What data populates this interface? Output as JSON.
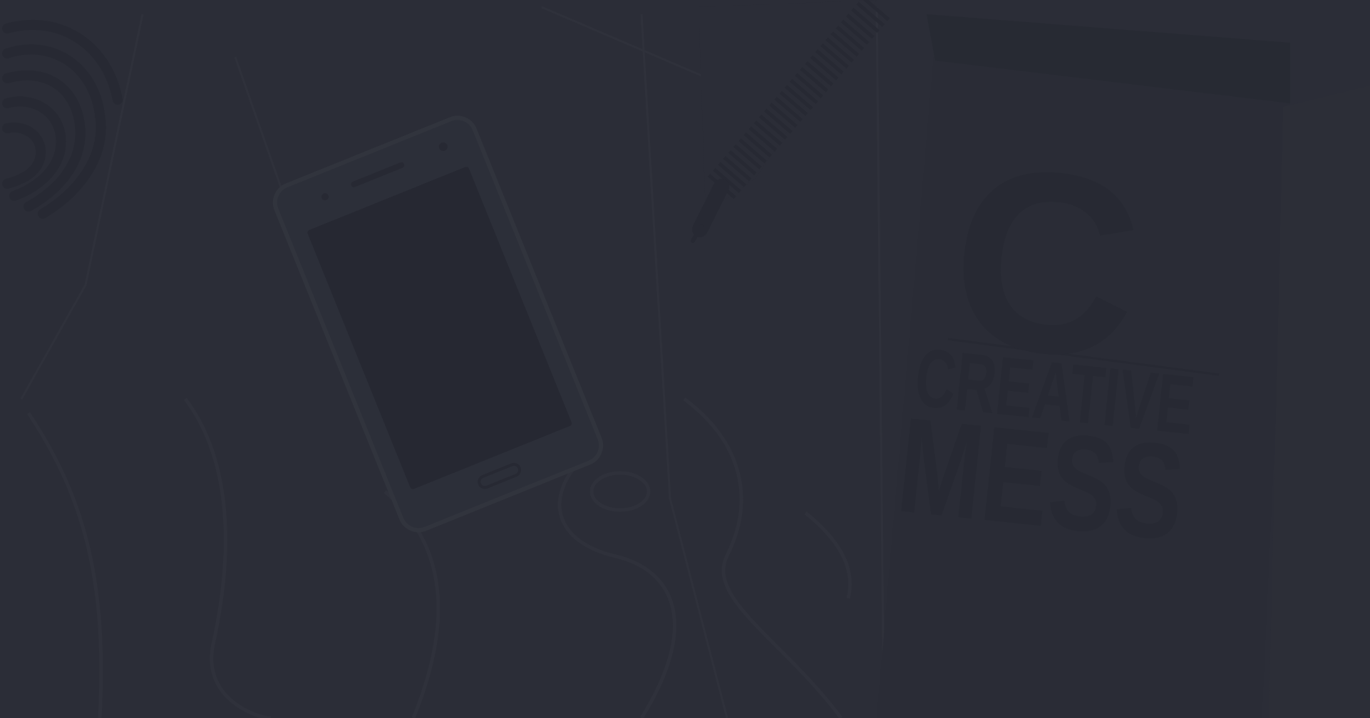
{
  "background": {
    "base_color": "#2b2e37",
    "overlay_color": "#2a2d36"
  },
  "notebook_cover": {
    "letter": "C",
    "line1": "CREATIVE",
    "line2": "MESS"
  },
  "objects": {
    "phone": "smartphone-image",
    "pen": "pen-image",
    "fingerprint": "fingerprint-icon",
    "earphones": "earphones-image"
  }
}
